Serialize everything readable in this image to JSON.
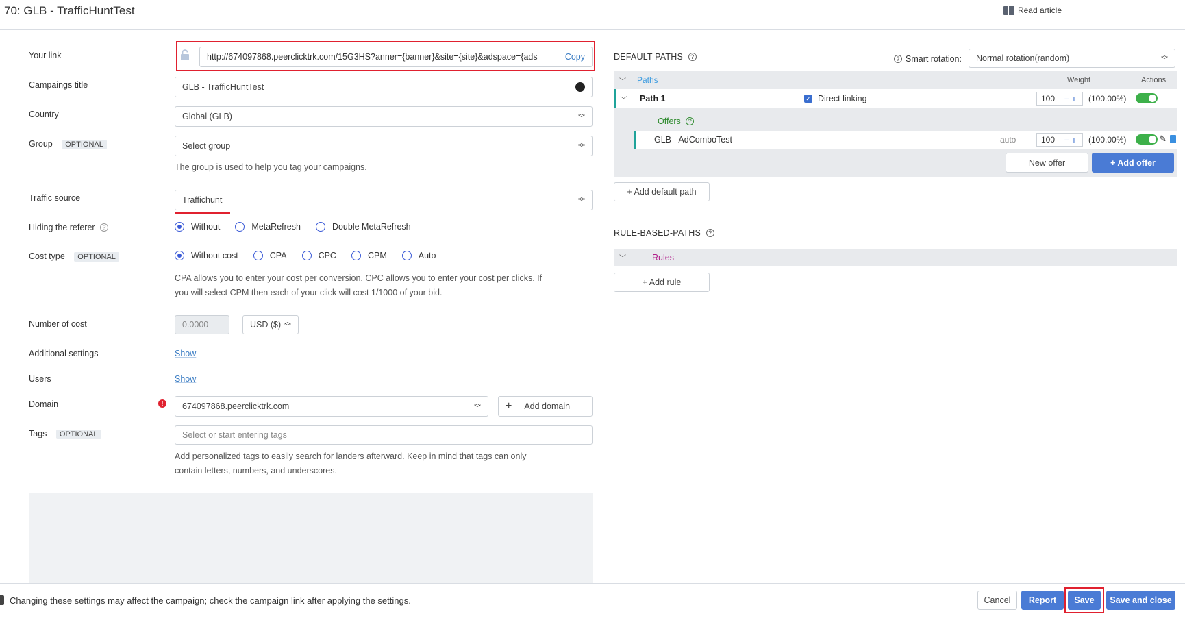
{
  "header": {
    "title": "70: GLB - TrafficHuntTest",
    "read_article": "Read article"
  },
  "form": {
    "your_link": {
      "label": "Your link",
      "value": "http://674097868.peerclicktrk.com/15G3HS?anner={banner}&site={site}&adspace={ads",
      "copy": "Copy"
    },
    "campaign_title": {
      "label": "Campaings title",
      "value": "GLB - TrafficHuntTest"
    },
    "country": {
      "label": "Country",
      "value": "Global (GLB)"
    },
    "group": {
      "label": "Group",
      "optional": "OPTIONAL",
      "placeholder": "Select group",
      "help": "The group is used to help you tag your campaigns."
    },
    "traffic_source": {
      "label": "Traffic source",
      "value": "Traffichunt"
    },
    "hiding_referer": {
      "label": "Hiding the referer",
      "options": [
        "Without",
        "MetaRefresh",
        "Double MetaRefresh"
      ],
      "selected": "Without"
    },
    "cost_type": {
      "label": "Cost type",
      "optional": "OPTIONAL",
      "options": [
        "Without cost",
        "CPA",
        "CPC",
        "CPM",
        "Auto"
      ],
      "selected": "Without cost",
      "help_line1": "CPA allows you to enter your cost per conversion. CPC allows you to enter your cost per clicks. If",
      "help_line2": "you will select CPM then each of your click will cost 1/1000 of your bid."
    },
    "number_of_cost": {
      "label": "Number of cost",
      "value": "0.0000",
      "currency": "USD ($)"
    },
    "additional_settings": {
      "label": "Additional settings",
      "link": "Show"
    },
    "users": {
      "label": "Users",
      "link": "Show"
    },
    "domain": {
      "label": "Domain",
      "value": "674097868.peerclicktrk.com",
      "add_label": "Add domain"
    },
    "tags": {
      "label": "Tags",
      "optional": "OPTIONAL",
      "placeholder": "Select or start entering tags",
      "help_line1": "Add personalized tags to easily search for landers afterward. Keep in mind that tags can only",
      "help_line2": "contain letters, numbers, and underscores."
    }
  },
  "right": {
    "default_paths_title": "DEFAULT PATHS",
    "smart_rotation_label": "Smart rotation:",
    "smart_rotation_value": "Normal rotation(random)",
    "table_headers": {
      "paths": "Paths",
      "weight": "Weight",
      "actions": "Actions"
    },
    "path": {
      "name": "Path 1",
      "direct_linking": "Direct linking",
      "weight": "100",
      "percent": "(100.00%)"
    },
    "offers_label": "Offers",
    "offer": {
      "name": "GLB - AdComboTest",
      "mode": "auto",
      "weight": "100",
      "percent": "(100.00%)"
    },
    "new_offer": "New offer",
    "add_offer": "+ Add offer",
    "add_default_path": "+ Add default path",
    "rule_based_title": "RULE-BASED-PATHS",
    "rules_label": "Rules",
    "add_rule": "+ Add rule"
  },
  "footer": {
    "warning": "Changing these settings may affect the campaign; check the campaign link after applying the settings.",
    "cancel": "Cancel",
    "report": "Report",
    "save": "Save",
    "save_close": "Save and close"
  },
  "colors": {
    "accent": "#4a7bd5",
    "toggle_on": "#3db04a",
    "highlight": "#e0212f",
    "path_marker": "#1fa39a"
  }
}
